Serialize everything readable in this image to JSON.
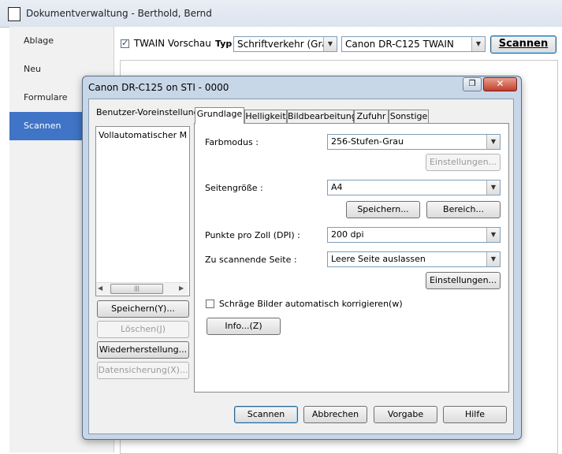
{
  "window": {
    "title": "Dokumentverwaltung - Berthold, Bernd"
  },
  "sidebar": {
    "items": [
      {
        "label": "Ablage"
      },
      {
        "label": "Neu"
      },
      {
        "label": "Formulare"
      },
      {
        "label": "Scannen"
      }
    ]
  },
  "toolbar": {
    "twain_preview_label": "TWAIN Vorschau",
    "twain_preview_checked": true,
    "type_label": "Typ",
    "type_value": "Schriftverkehr (Grau)",
    "scanner_value": "Canon DR-C125 TWAIN",
    "scan_button": "Scannen"
  },
  "dialog": {
    "title": "Canon DR-C125 on STI - 0000",
    "preset_label": "Benutzer-Voreinstellung :",
    "preset_item": "Vollautomatischer Modus",
    "left_buttons": {
      "save": "Speichern(Y)...",
      "delete": "Löschen(J)",
      "restore": "Wiederherstellung...",
      "backup": "Datensicherung(X)..."
    },
    "tabs": [
      "Grundlage",
      "Helligkeit",
      "Bildbearbeitung",
      "Zufuhr",
      "Sonstige"
    ],
    "fields": {
      "color_mode_label": "Farbmodus :",
      "color_mode_value": "256-Stufen-Grau",
      "color_settings_button": "Einstellungen...",
      "page_size_label": "Seitengröße :",
      "page_size_value": "A4",
      "page_save_button": "Speichern...",
      "page_area_button": "Bereich...",
      "dpi_label": "Punkte pro Zoll (DPI) :",
      "dpi_value": "200 dpi",
      "side_label": "Zu scannende Seite :",
      "side_value": "Leere Seite auslassen",
      "side_settings_button": "Einstellungen...",
      "deskew_label": "Schräge Bilder automatisch korrigieren(w)",
      "deskew_checked": false,
      "info_button": "Info...(Z)"
    },
    "bottom_buttons": {
      "scan": "Scannen",
      "cancel": "Abbrechen",
      "default": "Vorgabe",
      "help": "Hilfe"
    }
  }
}
